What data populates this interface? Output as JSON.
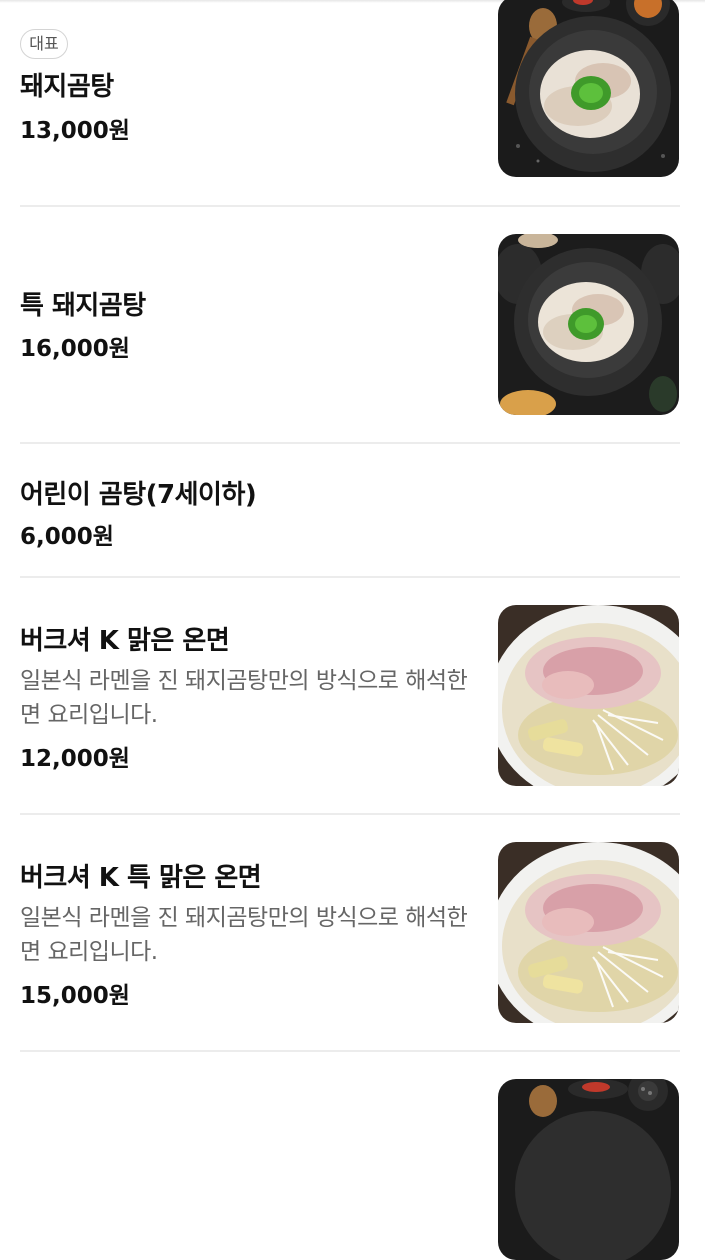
{
  "menu": {
    "items": [
      {
        "badge": "대표",
        "name": "돼지곰탕",
        "price": "13,000원",
        "image": "bowl-black-icon"
      },
      {
        "name": "특 돼지곰탕",
        "price": "16,000원",
        "image": "bowl-black-icon"
      },
      {
        "name": "어린이 곰탕(7세이하)",
        "price": "6,000원"
      },
      {
        "name": "버크셔 K 맑은 온면",
        "description": "일본식 라멘을 진 돼지곰탕만의 방식으로 해석한 면 요리입니다.",
        "price": "12,000원",
        "image": "ramen-bowl-icon"
      },
      {
        "name": "버크셔 K 특 맑은 온면",
        "description": "일본식 라멘을 진 돼지곰탕만의 방식으로 해석한 면 요리입니다.",
        "price": "15,000원",
        "image": "ramen-bowl-icon"
      }
    ]
  },
  "colors": {
    "text_primary": "#111111",
    "text_secondary": "#666666",
    "divider": "#ececec",
    "badge_border": "#d4d4d4"
  }
}
